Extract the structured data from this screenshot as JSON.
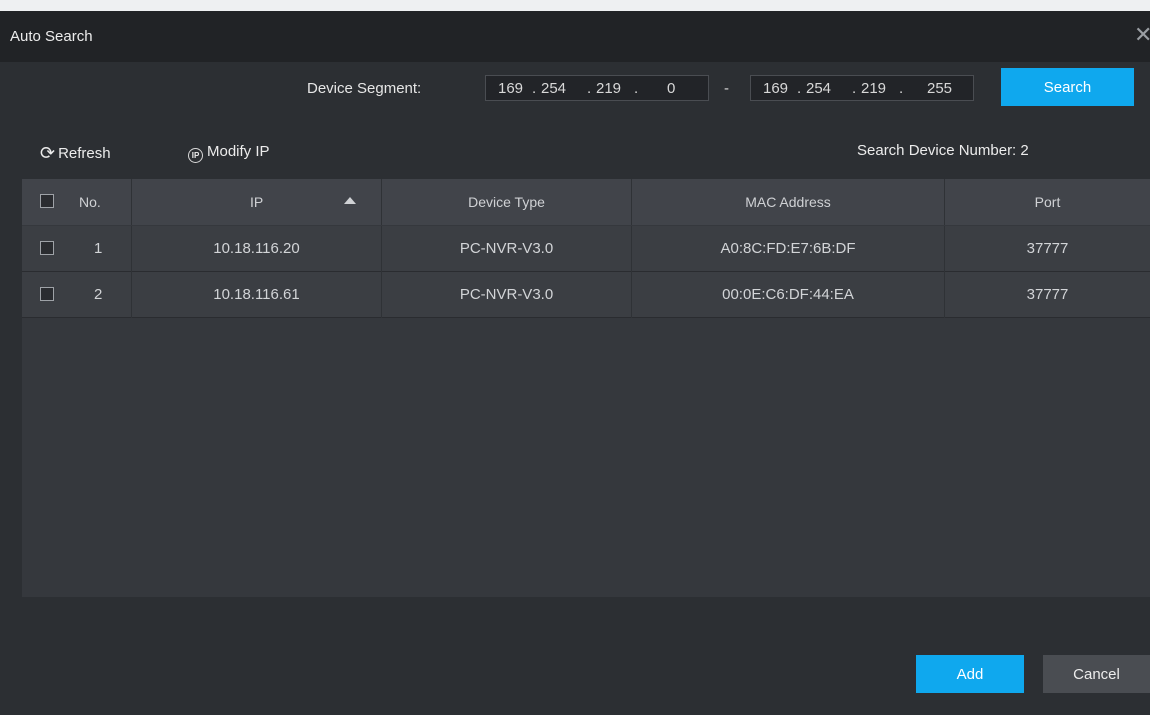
{
  "window": {
    "title": "Auto Search",
    "close_glyph": "✕"
  },
  "segment": {
    "label": "Device Segment:",
    "start": [
      "169",
      "254",
      "219",
      "0"
    ],
    "end": [
      "169",
      "254",
      "219",
      "255"
    ],
    "dash": "-",
    "dot": "."
  },
  "toolbar": {
    "search_label": "Search",
    "refresh_label": "Refresh",
    "modify_ip_label": "Modify IP",
    "ip_icon_text": "IP",
    "search_count_label": "Search Device Number:",
    "search_count": "2"
  },
  "table": {
    "headers": [
      "No.",
      "IP",
      "Device Type",
      "MAC Address",
      "Port"
    ],
    "rows": [
      {
        "no": "1",
        "ip": "10.18.116.20",
        "type": "PC-NVR-V3.0",
        "mac": "A0:8C:FD:E7:6B:DF",
        "port": "37777"
      },
      {
        "no": "2",
        "ip": "10.18.116.61",
        "type": "PC-NVR-V3.0",
        "mac": "00:0E:C6:DF:44:EA",
        "port": "37777"
      }
    ]
  },
  "footer": {
    "add_label": "Add",
    "cancel_label": "Cancel"
  },
  "icons": {
    "refresh": "refresh-icon",
    "modify_ip": "ip-circle-icon",
    "close": "close-icon",
    "sort": "sort-ascending-icon"
  },
  "colors": {
    "accent": "#0fa8ee",
    "background": "#2c2f33",
    "titlebar": "#212326"
  }
}
